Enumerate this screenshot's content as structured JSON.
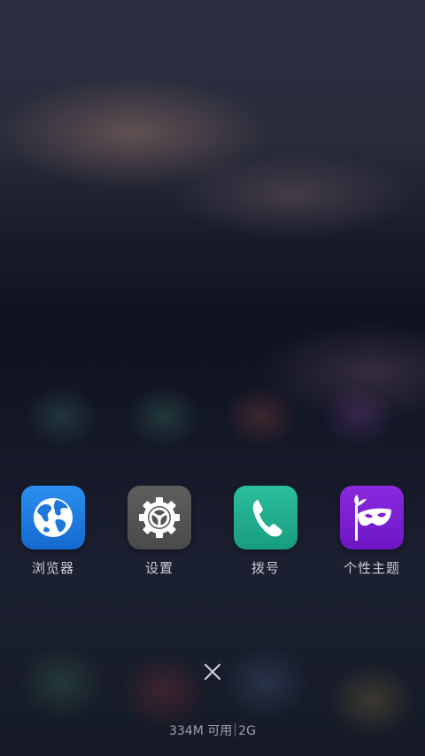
{
  "recent_apps": [
    {
      "label": "浏览器",
      "icon": "globe-icon",
      "color": "#1f7fe0"
    },
    {
      "label": "设置",
      "icon": "gear-icon",
      "color": "#555555"
    },
    {
      "label": "拨号",
      "icon": "phone-icon",
      "color": "#1fae8e"
    },
    {
      "label": "个性主题",
      "icon": "mask-icon",
      "color": "#7b1fd2"
    }
  ],
  "close_button": {
    "icon": "close-icon"
  },
  "memory_status": {
    "available": "334M 可用",
    "total": "2G"
  }
}
